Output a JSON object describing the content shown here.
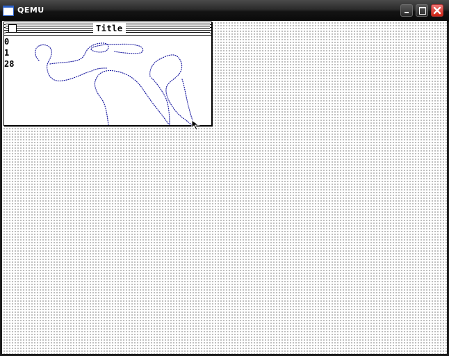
{
  "window": {
    "title": "QEMU",
    "icon": "qemu-window-icon",
    "buttons": {
      "minimize": "minimize-icon",
      "maximize": "maximize-icon",
      "close": "close-icon"
    }
  },
  "guest": {
    "window": {
      "title": "Title",
      "closebox": "closebox-icon"
    },
    "readouts": [
      "0",
      "1",
      "28"
    ],
    "desktop_pattern": "dotted-gray",
    "stroke_color": "#1a1aa0"
  },
  "colors": {
    "titlebar": "#1c1c1c",
    "close_button": "#d33a2a",
    "desktop_dots": "#000000",
    "desktop_bg": "#ffffff"
  }
}
